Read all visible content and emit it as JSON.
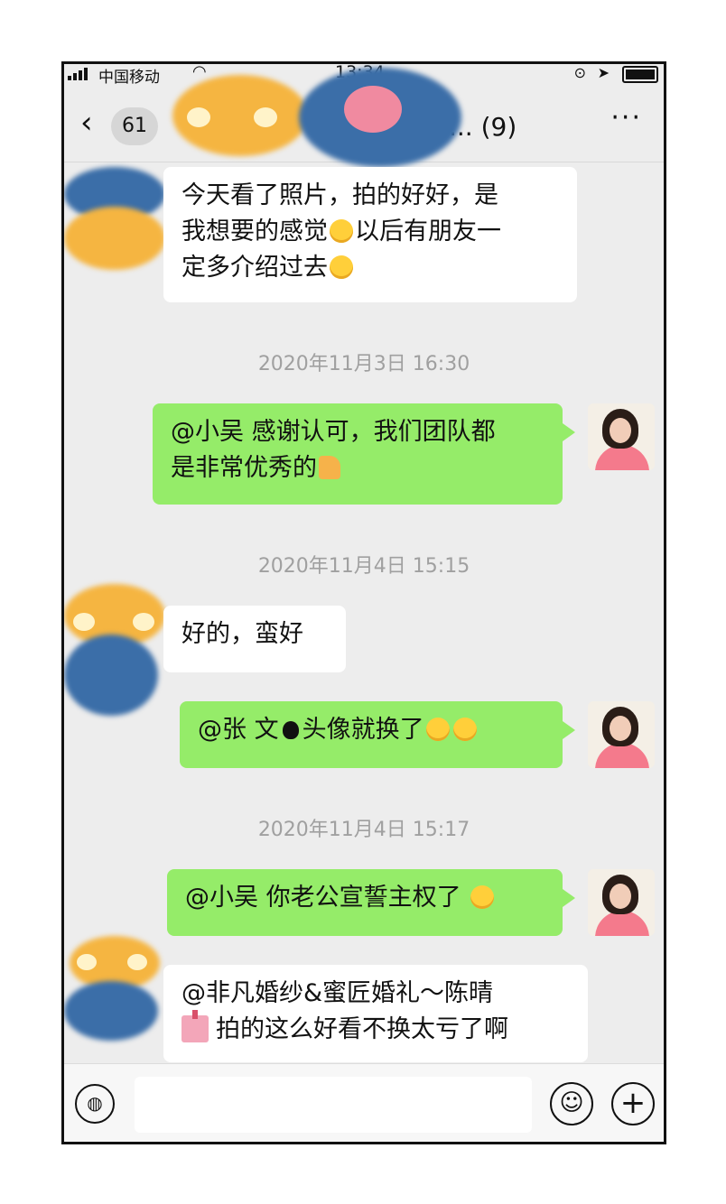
{
  "status_bar": {
    "carrier": "中国移动",
    "time": "13:34"
  },
  "nav": {
    "back_count": "61",
    "title": "摄沟... (9)",
    "more": "···"
  },
  "messages": [
    {
      "id": "m1",
      "side": "in",
      "text_parts": [
        "今天看了照片，拍的好好，是",
        "我想要的感觉",
        "以后有朋友一",
        "定多介绍过去"
      ]
    },
    {
      "id": "m2",
      "side": "out",
      "text_parts": [
        "@小吴 感谢认可，我们团队都",
        "是非常优秀的"
      ]
    },
    {
      "id": "m3",
      "side": "in",
      "text_parts": [
        "好的，蛮好"
      ]
    },
    {
      "id": "m4",
      "side": "out",
      "text_parts": [
        "@张   文",
        "头像就换了"
      ]
    },
    {
      "id": "m5",
      "side": "out",
      "text_parts": [
        "@小吴 你老公宣誓主权了"
      ]
    },
    {
      "id": "m6",
      "side": "in",
      "text_parts": [
        "@非凡婚纱&蜜匠婚礼～陈晴",
        "拍的这么好看不换太亏了啊"
      ]
    }
  ],
  "timestamps": [
    "2020年11月3日 16:30",
    "2020年11月4日 15:15",
    "2020年11月4日 15:17"
  ],
  "colors": {
    "out_bubble": "#95ec69",
    "in_bubble": "#ffffff",
    "background": "#ededed"
  },
  "input_bar": {
    "voice_icon": "voice-icon",
    "emoji_icon": "emoji-icon",
    "plus_icon": "plus-icon"
  }
}
